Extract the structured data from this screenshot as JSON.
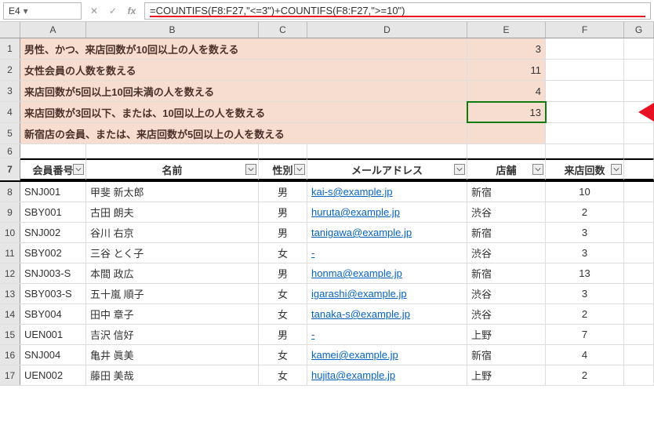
{
  "nameBox": "E4",
  "formula": "=COUNTIFS(F8:F27,\"<=3\")+COUNTIFS(F8:F27,\">=10\")",
  "columns": [
    "A",
    "B",
    "C",
    "D",
    "E",
    "F",
    "G"
  ],
  "summaries": [
    {
      "label": "男性、かつ、来店回数が10回以上の人を数える",
      "val": "3"
    },
    {
      "label": "女性会員の人数を数える",
      "val": "11"
    },
    {
      "label": "来店回数が5回以上10回未満の人を数える",
      "val": "4"
    },
    {
      "label": "来店回数が3回以下、または、10回以上の人を数える",
      "val": "13"
    },
    {
      "label": "新宿店の会員、または、来店回数が5回以上の人を数える",
      "val": ""
    }
  ],
  "headers": {
    "id": "会員番号",
    "name": "名前",
    "sex": "性別",
    "mail": "メールアドレス",
    "store": "店舗",
    "visits": "来店回数"
  },
  "rows": [
    {
      "id": "SNJ001",
      "name": "甲斐 新太郎",
      "sex": "男",
      "mail": "kai-s@example.jp",
      "store": "新宿",
      "visits": "10"
    },
    {
      "id": "SBY001",
      "name": "古田 朗夫",
      "sex": "男",
      "mail": "huruta@example.jp",
      "store": "渋谷",
      "visits": "2"
    },
    {
      "id": "SNJ002",
      "name": "谷川 右京",
      "sex": "男",
      "mail": "tanigawa@example.jp",
      "store": "新宿",
      "visits": "3"
    },
    {
      "id": "SBY002",
      "name": "三谷 とく子",
      "sex": "女",
      "mail": "-",
      "store": "渋谷",
      "visits": "3"
    },
    {
      "id": "SNJ003-S",
      "name": "本間 政広",
      "sex": "男",
      "mail": "honma@example.jp",
      "store": "新宿",
      "visits": "13"
    },
    {
      "id": "SBY003-S",
      "name": "五十嵐 順子",
      "sex": "女",
      "mail": "igarashi@example.jp",
      "store": "渋谷",
      "visits": "3"
    },
    {
      "id": "SBY004",
      "name": "田中 章子",
      "sex": "女",
      "mail": "tanaka-s@example.jp",
      "store": "渋谷",
      "visits": "2"
    },
    {
      "id": "UEN001",
      "name": "吉沢 信好",
      "sex": "男",
      "mail": "-",
      "store": "上野",
      "visits": "7"
    },
    {
      "id": "SNJ004",
      "name": "亀井 眞美",
      "sex": "女",
      "mail": "kamei@example.jp",
      "store": "新宿",
      "visits": "4"
    },
    {
      "id": "UEN002",
      "name": "藤田 美哉",
      "sex": "女",
      "mail": "hujita@example.jp",
      "store": "上野",
      "visits": "2"
    }
  ],
  "chart_data": {
    "type": "table",
    "title": "COUNTIFS summary",
    "categories": [
      "男性かつ来店10回以上",
      "女性会員",
      "来店5回以上10回未満",
      "来店3回以下または10回以上",
      "新宿店会員または来店5回以上"
    ],
    "values": [
      3,
      11,
      4,
      13,
      null
    ]
  }
}
